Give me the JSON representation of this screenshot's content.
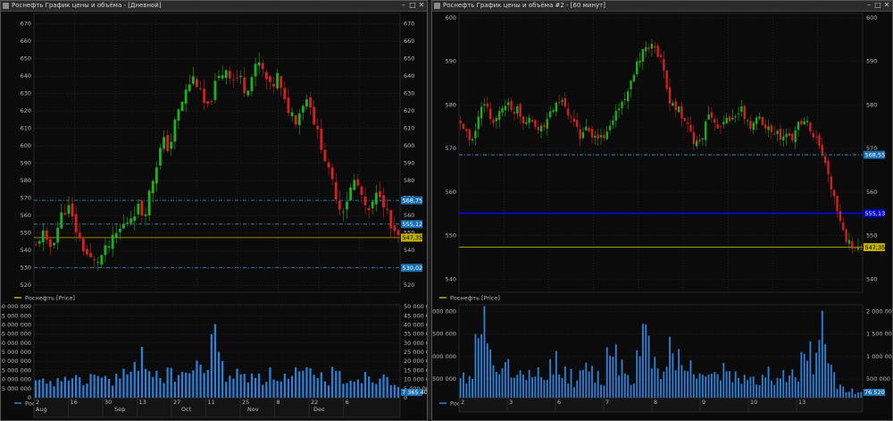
{
  "windows": {
    "left": {
      "title": "Роснефть График цены и объёма - [Дневной]",
      "price_legend": "Роснефть [Price]",
      "volume_legend": "Роснефть [Volume]",
      "price_ticks": [
        "670",
        "660",
        "650",
        "640",
        "630",
        "620",
        "610",
        "600",
        "590",
        "580",
        "570",
        "560",
        "550",
        "540",
        "530",
        "520"
      ],
      "volume_ticks": [
        "50 000 000",
        "45 000 000",
        "40 000 000",
        "35 000 000",
        "30 000 000",
        "25 000 000",
        "20 000 000",
        "15 000 000",
        "10 000 000",
        "5 000 000",
        "0"
      ],
      "day_labels": [
        "2",
        "16",
        "30",
        "13",
        "27",
        "11",
        "25",
        "8",
        "22",
        "6"
      ],
      "month_labels": [
        "Aug",
        "Sep",
        "Oct",
        "Nov",
        "Dec"
      ],
      "price_tags": [
        {
          "text": "568,75",
          "color": "#1a6fb0"
        },
        {
          "text": "555,12",
          "color": "#1a6fb0"
        },
        {
          "text": "547,35",
          "color": "#bfb000"
        },
        {
          "text": "530,02",
          "color": "#1a6fb0"
        }
      ],
      "volume_tag": "7 365 407"
    },
    "right": {
      "title": "Роснефть График цены и объёма #2 - [60 минут]",
      "price_legend": "Роснефть [Price]",
      "volume_legend": "Роснефть [Volume]",
      "price_ticks": [
        "600",
        "590",
        "580",
        "570",
        "560",
        "550",
        "540"
      ],
      "volume_ticks": [
        "2 000 000",
        "1 500 000",
        "1 000 000",
        "500 000"
      ],
      "day_labels": [
        "2",
        "3",
        "6",
        "7",
        "8",
        "9",
        "10",
        "13"
      ],
      "price_tags": [
        {
          "text": "568,55",
          "color": "#1a6fb0"
        },
        {
          "text": "555,13",
          "color": "#0000cc"
        },
        {
          "text": "547,35",
          "color": "#bfb000"
        }
      ],
      "volume_tag": "76 520"
    }
  },
  "colors": {
    "up": "#1fae1f",
    "down": "#d42020",
    "volume": "#2e7fd6",
    "level": "#2a9fd8",
    "current": "#bfb000",
    "support": "#0000ff"
  },
  "chart_data": [
    {
      "type": "candlestick",
      "title": "Роснефть График цены и объёма - [Дневной]",
      "price_range": [
        516,
        676
      ],
      "horizontal_levels": [
        568.75,
        555.12,
        547.35,
        530.02
      ],
      "close_path": [
        542,
        551,
        540,
        548,
        560,
        566,
        555,
        545,
        538,
        533,
        535,
        540,
        545,
        551,
        555,
        560,
        565,
        560,
        575,
        590,
        603,
        598,
        615,
        625,
        635,
        640,
        628,
        620,
        633,
        640,
        645,
        638,
        640,
        632,
        640,
        648,
        640,
        632,
        640,
        625,
        620,
        615,
        625,
        628,
        610,
        600,
        585,
        575,
        562,
        570,
        580,
        575,
        560,
        566,
        575,
        565,
        550,
        547
      ],
      "volume_path": [
        7,
        8,
        7,
        8,
        10,
        12,
        9,
        8,
        10,
        12,
        11,
        9,
        10,
        11,
        13,
        12,
        14,
        22,
        16,
        13,
        12,
        12,
        13,
        14,
        13,
        15,
        16,
        14,
        45,
        18,
        13,
        12,
        12,
        11,
        12,
        14,
        11,
        12,
        12,
        11,
        10,
        13,
        12,
        12,
        10,
        11,
        10,
        14,
        11,
        12,
        10,
        12,
        11,
        10,
        12,
        13,
        11,
        8
      ]
    },
    {
      "type": "candlestick",
      "title": "Роснефть График цены и объёма #2 - [60 минут]",
      "price_range": [
        537,
        601
      ],
      "horizontal_levels": [
        568.55,
        555.13,
        547.35
      ],
      "close_path": [
        576,
        573,
        571,
        577,
        580,
        578,
        576,
        579,
        581,
        578,
        580,
        576,
        578,
        575,
        574,
        576,
        579,
        581,
        580,
        577,
        575,
        573,
        574,
        572,
        573,
        572,
        575,
        578,
        580,
        583,
        585,
        590,
        592,
        594,
        593,
        591,
        583,
        580,
        579,
        576,
        574,
        571,
        572,
        576,
        578,
        575,
        577,
        576,
        578,
        579,
        576,
        575,
        577,
        576,
        575,
        574,
        572,
        573,
        572,
        576,
        577,
        575,
        572,
        570,
        565,
        560,
        555,
        550,
        548,
        546,
        547
      ],
      "volume_path": [
        0.4,
        0.5,
        0.6,
        1.2,
        2.0,
        1.5,
        0.6,
        0.5,
        0.7,
        0.5,
        0.6,
        0.4,
        0.5,
        0.4,
        0.6,
        0.4,
        0.7,
        0.9,
        0.6,
        0.5,
        0.4,
        0.5,
        0.7,
        0.6,
        0.5,
        0.4,
        1.0,
        1.3,
        0.8,
        0.6,
        0.5,
        0.9,
        1.4,
        1.1,
        0.8,
        0.6,
        0.9,
        1.3,
        0.9,
        0.7,
        0.8,
        0.6,
        0.5,
        0.7,
        0.6,
        0.5,
        0.7,
        0.6,
        0.5,
        0.4,
        0.6,
        0.5,
        0.4,
        0.5,
        0.6,
        0.4,
        0.5,
        0.4,
        0.5,
        0.6,
        0.9,
        1.1,
        0.8,
        1.5,
        1.3,
        0.7,
        0.3,
        0.2,
        0.2,
        0.1,
        0.1
      ]
    }
  ]
}
